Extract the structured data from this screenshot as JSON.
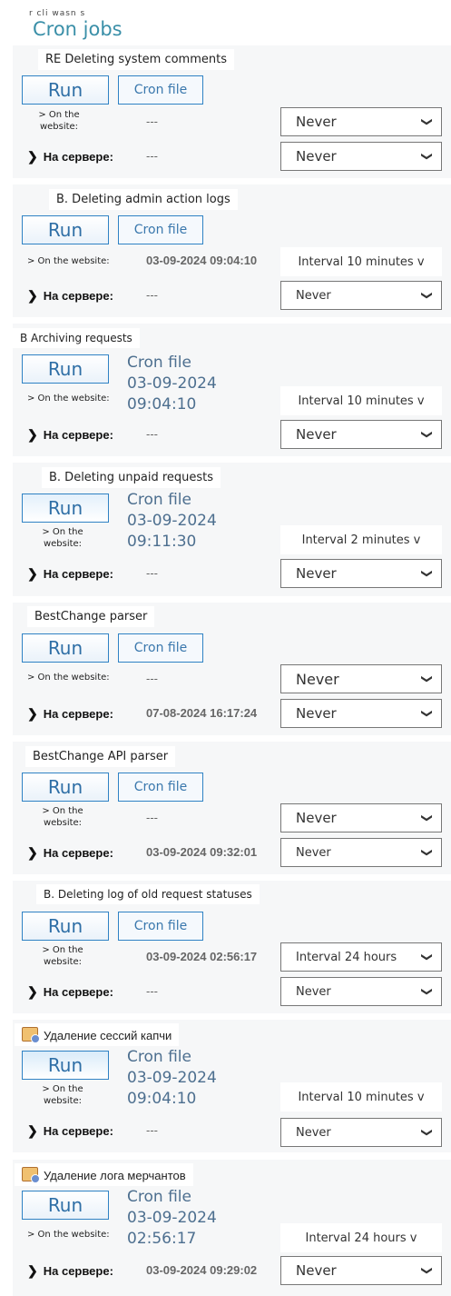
{
  "header": {
    "small": "r cli wasn s",
    "title": "Cron jobs"
  },
  "common": {
    "run": "Run",
    "cron_file": "Cron file",
    "on_website": "> On the website:",
    "on_server": "На сервере:",
    "never": "Never",
    "dash": "---"
  },
  "jobs": [
    {
      "title": "RE Deleting system comments",
      "web_val": "---",
      "web_select": "Never",
      "srv_val": "---",
      "srv_select": "Never"
    },
    {
      "title": "B. Deleting admin action logs",
      "web_val": "03-09-2024 09:04:10",
      "web_select": "Interval 10 minutes v",
      "srv_val": "---",
      "srv_select": "Never"
    },
    {
      "title": "B Archiving requests",
      "cron_lines": [
        "Cron file",
        "03-09-2024",
        "09:04:10"
      ],
      "web_select": "Interval 10 minutes v",
      "srv_val": "---",
      "srv_select": "Never"
    },
    {
      "title": "B. Deleting unpaid requests",
      "cron_lines": [
        "Cron file",
        "03-09-2024",
        "09:11:30"
      ],
      "web_select": "Interval 2 minutes v",
      "srv_val": "---",
      "srv_select": "Never"
    },
    {
      "title": "BestChange parser",
      "web_val": "---",
      "web_select": "Never",
      "srv_val": "07-08-2024 16:17:24",
      "srv_select": "Never"
    },
    {
      "title": "BestChange API parser",
      "web_val": "---",
      "web_select": "Never",
      "srv_val": "03-09-2024 09:32:01",
      "srv_select": "Never"
    },
    {
      "title": "B. Deleting log of old request statuses",
      "web_val": "03-09-2024 02:56:17",
      "web_select": "Interval 24 hours",
      "srv_val": "---",
      "srv_select": "Never"
    },
    {
      "title": "Удаление сессий капчи",
      "cron_lines": [
        "Cron file",
        "03-09-2024",
        "09:04:10"
      ],
      "web_select": "Interval 10 minutes v",
      "srv_val": "---",
      "srv_select": "Never"
    },
    {
      "title": "Удаление лога мерчантов",
      "cron_lines": [
        "Cron file",
        "03-09-2024",
        "02:56:17"
      ],
      "web_select": "Interval 24 hours v",
      "srv_val": "03-09-2024 09:29:02",
      "srv_select": "Never"
    }
  ]
}
